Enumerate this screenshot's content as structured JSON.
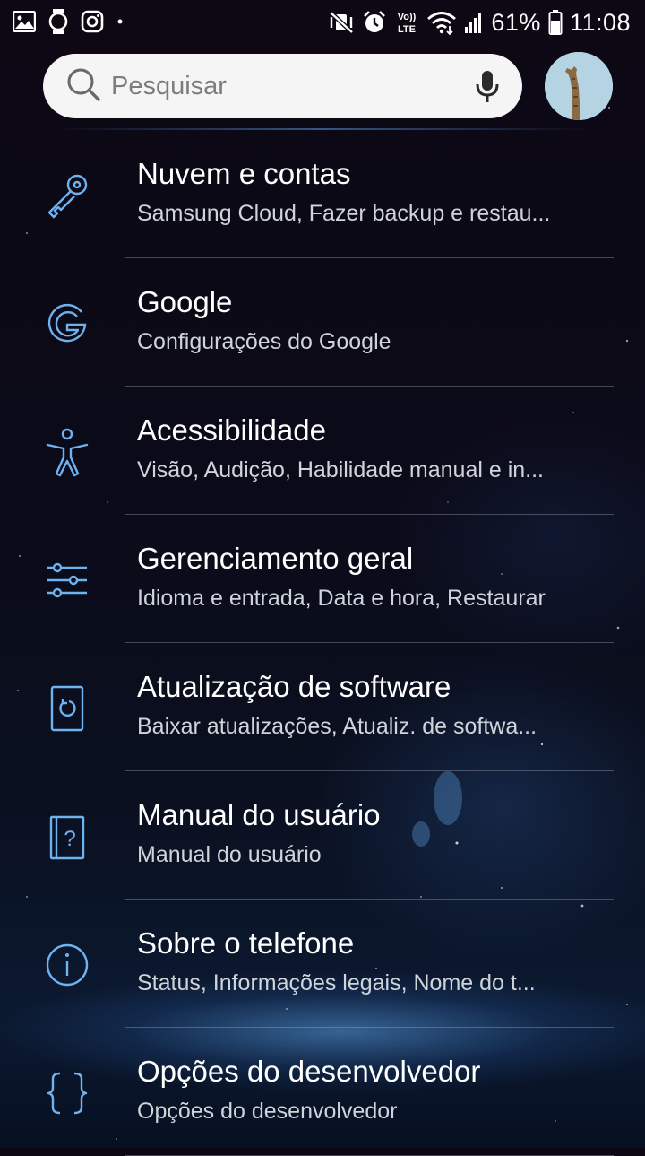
{
  "status_bar": {
    "battery": "61%",
    "time": "11:08",
    "left_icons": [
      "gallery-icon",
      "watch-icon",
      "instagram-icon",
      "dot-icon"
    ],
    "right_icons": [
      "mute-vibrate-icon",
      "alarm-icon",
      "volte-icon",
      "wifi-icon",
      "signal-icon",
      "battery-icon"
    ],
    "volte_label": "Vo)) LTE"
  },
  "search": {
    "placeholder": "Pesquisar"
  },
  "colors": {
    "icon_accent": "#6fb2f0",
    "search_bg": "#f5f5f5",
    "subtitle": "#cfd3da"
  },
  "settings": [
    {
      "icon": "key-icon",
      "title": "Nuvem e contas",
      "subtitle": "Samsung Cloud, Fazer backup e restau..."
    },
    {
      "icon": "google-icon",
      "title": "Google",
      "subtitle": "Configurações do Google"
    },
    {
      "icon": "accessibility-icon",
      "title": "Acessibilidade",
      "subtitle": "Visão, Audição, Habilidade manual e in..."
    },
    {
      "icon": "sliders-icon",
      "title": "Gerenciamento geral",
      "subtitle": "Idioma e entrada, Data e hora, Restaurar"
    },
    {
      "icon": "software-update-icon",
      "title": "Atualização de software",
      "subtitle": "Baixar atualizações, Atualiz. de softwa..."
    },
    {
      "icon": "user-manual-icon",
      "title": "Manual do usuário",
      "subtitle": "Manual do usuário"
    },
    {
      "icon": "info-icon",
      "title": "Sobre o telefone",
      "subtitle": "Status, Informações legais, Nome do t..."
    },
    {
      "icon": "developer-braces-icon",
      "title": "Opções do desenvolvedor",
      "subtitle": "Opções do desenvolvedor"
    }
  ]
}
